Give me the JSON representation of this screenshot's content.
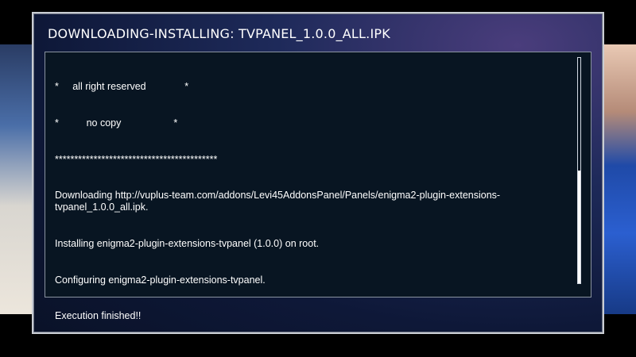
{
  "window": {
    "title": "DOWNLOADING-INSTALLING: TVPANEL_1.0.0_ALL.IPK"
  },
  "console": {
    "lines": [
      "*     all right reserved              *",
      "*          no copy                   *",
      "******************************************",
      "Downloading http://vuplus-team.com/addons/Levi45AddonsPanel/Panels/enigma2-plugin-extensions-tvpanel_1.0.0_all.ipk.",
      "Installing enigma2-plugin-extensions-tvpanel (1.0.0) on root.",
      "Configuring enigma2-plugin-extensions-tvpanel.",
      "Execution finished!!"
    ]
  },
  "scrollbar": {
    "visible_fraction": 0.5
  },
  "colors": {
    "console_background": "#081522",
    "text": "#ffffff",
    "frame_border": "#c9cdd4"
  }
}
